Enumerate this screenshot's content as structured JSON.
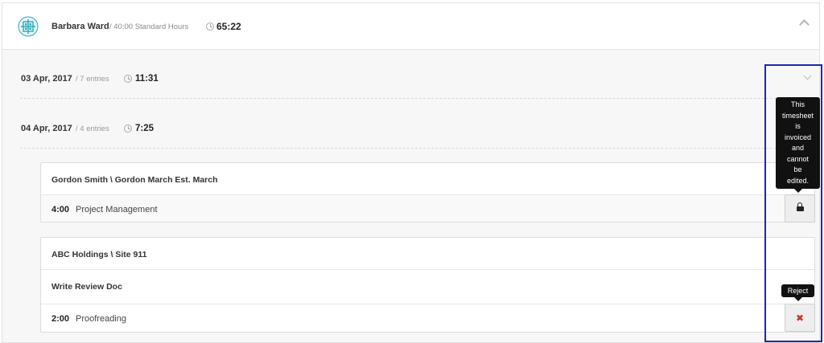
{
  "header": {
    "avatar_icon": "quilt-avatar-icon",
    "user_name": "Barbara Ward",
    "standard_hours": "/ 40:00 Standard Hours",
    "total_time": "65:22"
  },
  "days": [
    {
      "date": "03 Apr, 2017",
      "entries": "/ 7 entries",
      "time": "11:31"
    },
    {
      "date": "04 Apr, 2017",
      "entries": "/ 4 entries",
      "time": "7:25"
    }
  ],
  "cards": [
    {
      "project": "Gordon Smith \\ Gordon March Est. March",
      "entry": {
        "time": "4:00",
        "task": "Project Management"
      },
      "action_icon": "lock-icon",
      "tooltip": [
        "This",
        "timesheet",
        "is",
        "invoiced",
        "and",
        "cannot",
        "be",
        "edited."
      ]
    },
    {
      "project": "ABC Holdings \\ Site 911",
      "subtitle": "Write Review Doc",
      "entry": {
        "time": "2:00",
        "task": "Proofreading"
      },
      "action_icon": "close-icon",
      "action_symbol": "✖",
      "tooltip": "Reject"
    }
  ],
  "colors": {
    "accent_teal": "#2aa8b8",
    "reject_red": "#c0392b",
    "highlight_blue": "#1a2aa8"
  }
}
